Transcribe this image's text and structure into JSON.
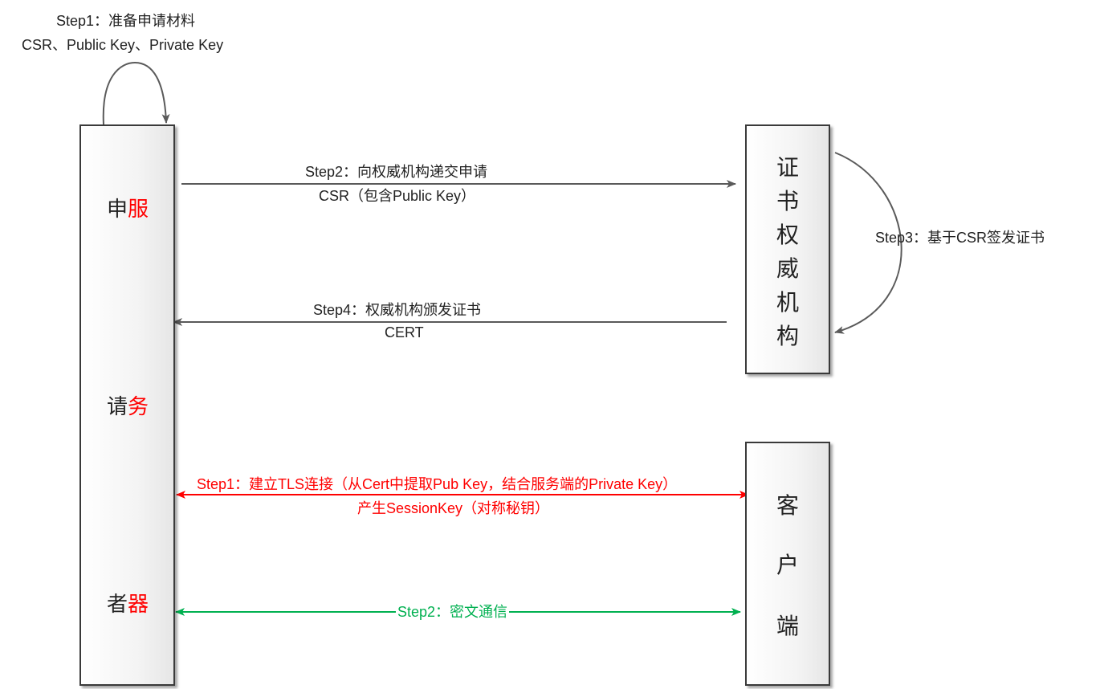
{
  "server": {
    "col1": [
      "申",
      "请",
      "者"
    ],
    "col2": [
      "服",
      "务",
      "器"
    ],
    "col2_color": "#ff0000"
  },
  "ca": {
    "chars": [
      "证",
      "书",
      "权",
      "威",
      "机",
      "构"
    ]
  },
  "client": {
    "chars": [
      "客",
      "户",
      "端"
    ]
  },
  "steps": {
    "s1_prepare": {
      "line1": "Step1：准备申请材料",
      "line2": "CSR、Public Key、Private Key"
    },
    "s2_submit": {
      "line1": "Step2：向权威机构递交申请",
      "line2": "CSR（包含Public Key）"
    },
    "s3_sign": {
      "line1": "Step3：基于CSR签发证书"
    },
    "s4_issue": {
      "line1": "Step4：权威机构颁发证书",
      "line2": "CERT"
    },
    "tls": {
      "line1": "Step1：建立TLS连接（从Cert中提取Pub Key，结合服务端的Private Key）",
      "line2": "产生SessionKey（对称秘钥）",
      "color": "#ff0000"
    },
    "encrypted": {
      "line1": "Step2：密文通信",
      "color": "#00b050"
    }
  },
  "colors": {
    "arrow_gray": "#5a5a5a",
    "red": "#ff0000",
    "green": "#00b050"
  }
}
